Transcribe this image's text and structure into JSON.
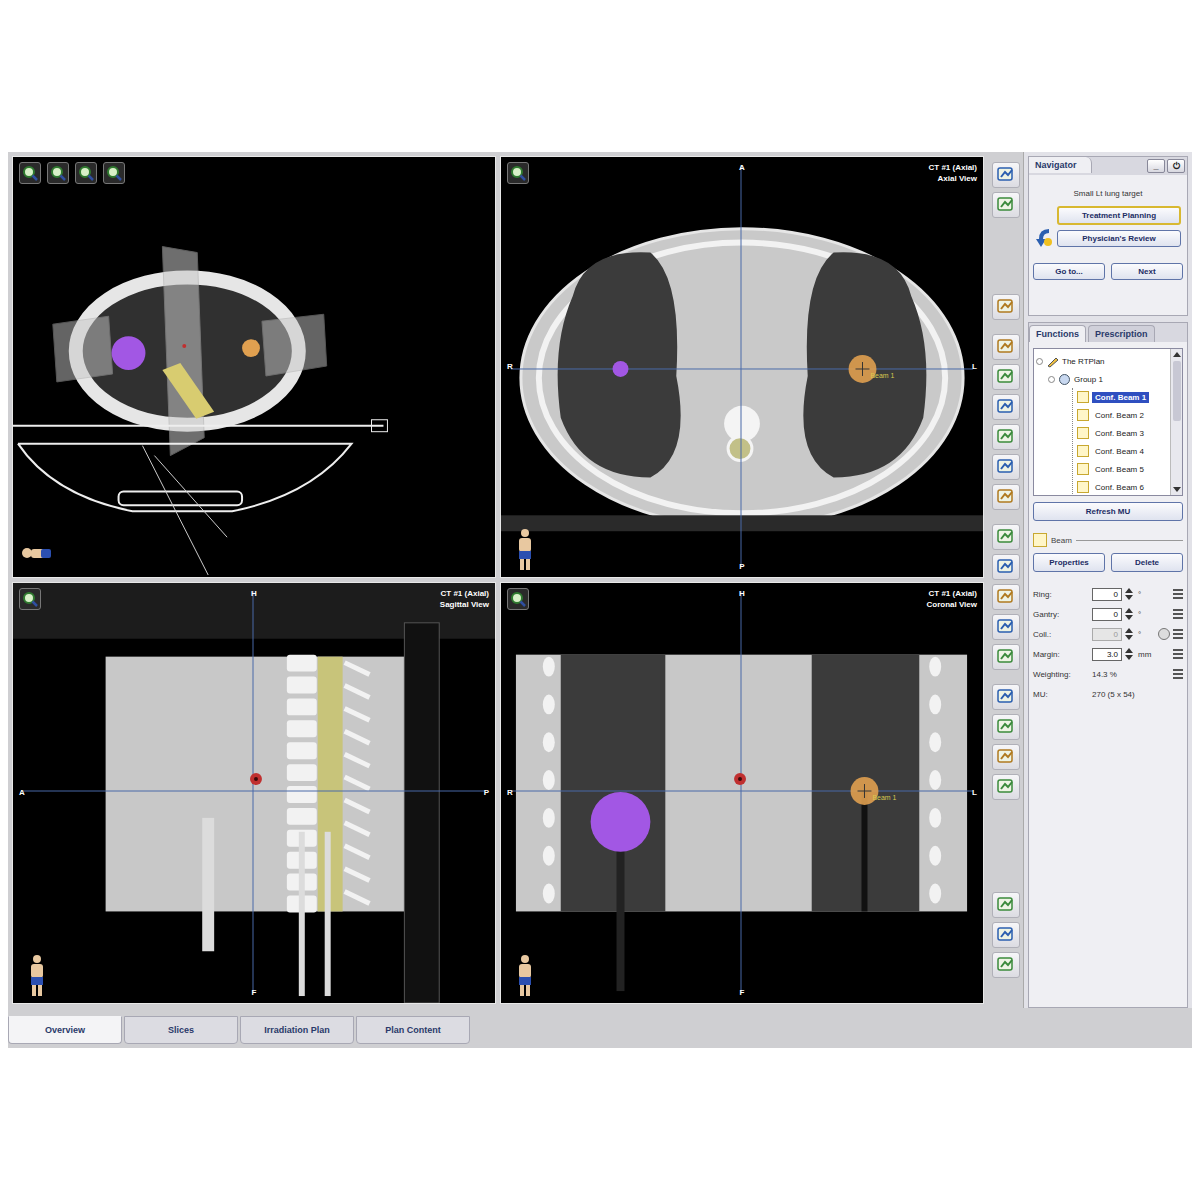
{
  "viewports": [
    {
      "kind": "3d",
      "title": "",
      "subtitle": "",
      "orientation": null
    },
    {
      "kind": "axial",
      "title": "CT #1 (Axial)",
      "subtitle": "Axial View",
      "orientation": {
        "top": "A",
        "bottom": "P",
        "left": "R",
        "right": "L"
      }
    },
    {
      "kind": "sagittal",
      "title": "CT #1 (Axial)",
      "subtitle": "Sagittal View",
      "orientation": {
        "top": "H",
        "bottom": "F",
        "left": "A",
        "right": "P"
      }
    },
    {
      "kind": "coronal",
      "title": "CT #1 (Axial)",
      "subtitle": "Coronal View",
      "orientation": {
        "top": "H",
        "bottom": "F",
        "left": "R",
        "right": "L"
      }
    }
  ],
  "targets": [
    {
      "color": "#a257e4",
      "label": ""
    },
    {
      "color": "#e0a050",
      "label": "Beam 1"
    }
  ],
  "navigator": {
    "title": "Navigator",
    "controls": [
      "_",
      "⏻"
    ],
    "case": "Small Lt lung target",
    "steps": [
      {
        "label": "Treatment Planning",
        "selected": true
      },
      {
        "label": "Physician's Review",
        "selected": false
      }
    ],
    "buttons": [
      "Go to...",
      "Next"
    ]
  },
  "panel_tabs": [
    {
      "label": "Functions",
      "selected": true
    },
    {
      "label": "Prescription",
      "selected": false
    }
  ],
  "tree": {
    "root": "The RTPlan",
    "group": "Group 1",
    "items": [
      {
        "label": "Conf. Beam 1",
        "selected": true
      },
      {
        "label": "Conf. Beam 2",
        "selected": false
      },
      {
        "label": "Conf. Beam 3",
        "selected": false
      },
      {
        "label": "Conf. Beam 4",
        "selected": false
      },
      {
        "label": "Conf. Beam 5",
        "selected": false
      },
      {
        "label": "Conf. Beam 6",
        "selected": false
      }
    ]
  },
  "refresh_button": "Refresh MU",
  "beam_label": "Beam",
  "actions": [
    "Properties",
    "Delete"
  ],
  "fields": [
    {
      "kind": "spin",
      "label": "Ring:",
      "value": "0",
      "unit": "°",
      "disabled": false
    },
    {
      "kind": "spin",
      "label": "Gantry:",
      "value": "0",
      "unit": "°",
      "disabled": false
    },
    {
      "kind": "spin",
      "label": "Coll.:",
      "value": "0",
      "unit": "°",
      "disabled": true
    },
    {
      "kind": "spin",
      "label": "Margin:",
      "value": "3.0",
      "unit": "mm",
      "disabled": false
    },
    {
      "kind": "text",
      "label": "Weighting:",
      "value": "14.3 %",
      "unit": "",
      "disabled": false
    },
    {
      "kind": "text",
      "label": "MU:",
      "value": "270 (5 x 54)",
      "unit": "",
      "disabled": false
    }
  ],
  "bottom_tabs": [
    {
      "label": "Overview",
      "selected": true
    },
    {
      "label": "Slices",
      "selected": false
    },
    {
      "label": "Irradiation Plan",
      "selected": false
    },
    {
      "label": "Plan Content",
      "selected": false
    }
  ]
}
